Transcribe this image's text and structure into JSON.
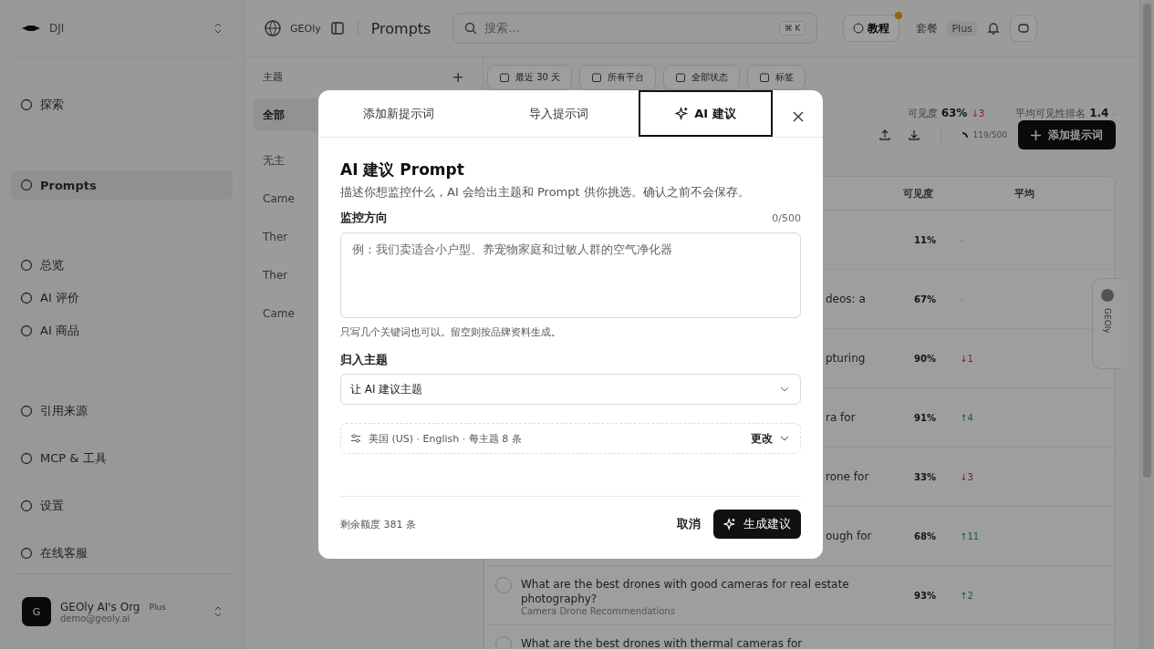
{
  "sidebar": {
    "workspace": "DJI",
    "items": [
      {
        "label": "探索",
        "selected": false
      },
      {
        "label": "Prompts",
        "selected": true
      },
      {
        "label": "总览",
        "selected": false
      },
      {
        "label": "AI 评价",
        "selected": false
      },
      {
        "label": "AI 商品",
        "selected": false
      },
      {
        "label": "引用来源",
        "selected": false
      },
      {
        "label": "MCP & 工具",
        "selected": false
      },
      {
        "label": "设置",
        "selected": false
      },
      {
        "label": "在线客服",
        "selected": false
      }
    ],
    "account": {
      "avatar": "G",
      "name": "GEOly AI's Org",
      "plan": "Plus",
      "email": "demo@geoly.ai"
    }
  },
  "topbar": {
    "brand": "GEOly",
    "page": "Prompts",
    "search_placeholder": "搜索...",
    "shortcut": "⌘ K",
    "tutorial": "教程",
    "plan_label": "套餐",
    "plan": "Plus"
  },
  "topics": {
    "title": "主题",
    "add": "+",
    "items": [
      {
        "label": "全部",
        "selected": true
      },
      {
        "label": "无主",
        "selected": false
      },
      {
        "label": "Came",
        "selected": false
      },
      {
        "label": "Ther",
        "selected": false
      },
      {
        "label": "Ther",
        "selected": false
      },
      {
        "label": "Came",
        "selected": false
      }
    ]
  },
  "filters": [
    "最近 30 天",
    "所有平台",
    "全部状态",
    "标签"
  ],
  "stats": [
    {
      "label": "可见度",
      "value": "63%",
      "change": "↓3",
      "color": "#881818"
    },
    {
      "label": "平均可见性排名",
      "value": "1.4",
      "change": "-"
    }
  ],
  "toolbar": {
    "quota": "119/500",
    "add": "添加提示词"
  },
  "table": {
    "columns": [
      "可见度",
      "平均"
    ],
    "rows": [
      {
        "kind": "covered",
        "visibility": "11%",
        "trend": "-"
      },
      {
        "kind": "covered",
        "question": "deos: a",
        "visibility": "67%",
        "trend": "-"
      },
      {
        "kind": "covered",
        "question": "pturing",
        "visibility": "90%",
        "trend": "↓1",
        "color": "#881818"
      },
      {
        "kind": "covered",
        "question": "ra for",
        "visibility": "91%",
        "trend": "↑4",
        "color": "#0e652e"
      },
      {
        "kind": "covered",
        "question": "rone for",
        "visibility": "33%",
        "trend": "↓3",
        "color": "#881818"
      },
      {
        "kind": "covered",
        "question": "ough for",
        "visibility": "68%",
        "trend": "↑11",
        "color": "#0e652e"
      },
      {
        "kind": "full",
        "checked": false,
        "question": "What are the best drones with good cameras for real estate photography?",
        "topic": "Camera Drone Recommendations",
        "visibility": "93%",
        "trend": "↑2",
        "color": "#0e652e"
      },
      {
        "kind": "full",
        "checked": false,
        "question": "What are the best drones with thermal cameras for"
      }
    ]
  },
  "side_tab": "GEOly",
  "modal": {
    "tabs": [
      {
        "label": "添加新提示词",
        "selected": false
      },
      {
        "label": "导入提示词",
        "selected": false
      },
      {
        "label": "AI 建议",
        "selected": true
      }
    ],
    "title": "AI 建议 Prompt",
    "description": "描述你想监控什么，AI 会给出主题和 Prompt 供你挑选。确认之前不会保存。",
    "field_label": "监控方向",
    "counter": "0/500",
    "placeholder": "例：我们卖适合小户型、养宠物家庭和过敏人群的空气净化器",
    "hint": "只写几个关键词也可以。留空则按品牌资料生成。",
    "topic_label": "归入主题",
    "topic_value": "让 AI 建议主题",
    "settings": "美国 (US) · English · 每主题 8 条",
    "change": "更改",
    "quota": "剩余额度 381 条",
    "cancel": "取消",
    "submit": "生成建议"
  }
}
